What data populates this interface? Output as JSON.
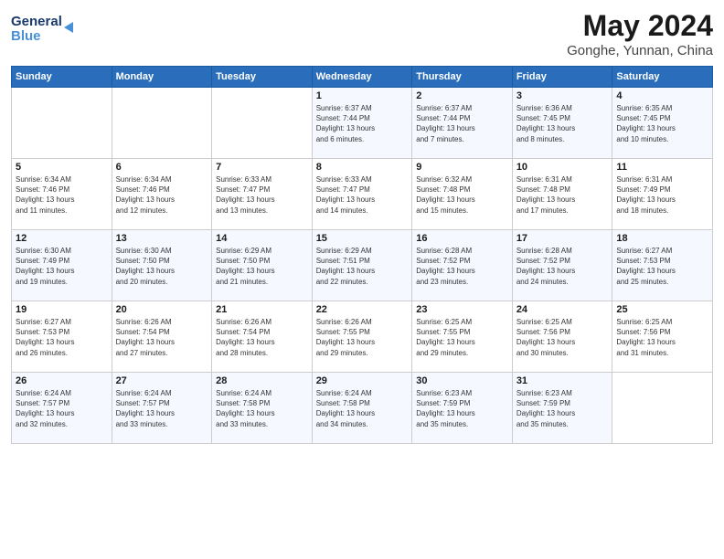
{
  "header": {
    "logo_line1": "General",
    "logo_line2": "Blue",
    "main_title": "May 2024",
    "subtitle": "Gonghe, Yunnan, China"
  },
  "weekdays": [
    "Sunday",
    "Monday",
    "Tuesday",
    "Wednesday",
    "Thursday",
    "Friday",
    "Saturday"
  ],
  "weeks": [
    [
      {
        "day": "",
        "info": ""
      },
      {
        "day": "",
        "info": ""
      },
      {
        "day": "",
        "info": ""
      },
      {
        "day": "1",
        "info": "Sunrise: 6:37 AM\nSunset: 7:44 PM\nDaylight: 13 hours\nand 6 minutes."
      },
      {
        "day": "2",
        "info": "Sunrise: 6:37 AM\nSunset: 7:44 PM\nDaylight: 13 hours\nand 7 minutes."
      },
      {
        "day": "3",
        "info": "Sunrise: 6:36 AM\nSunset: 7:45 PM\nDaylight: 13 hours\nand 8 minutes."
      },
      {
        "day": "4",
        "info": "Sunrise: 6:35 AM\nSunset: 7:45 PM\nDaylight: 13 hours\nand 10 minutes."
      }
    ],
    [
      {
        "day": "5",
        "info": "Sunrise: 6:34 AM\nSunset: 7:46 PM\nDaylight: 13 hours\nand 11 minutes."
      },
      {
        "day": "6",
        "info": "Sunrise: 6:34 AM\nSunset: 7:46 PM\nDaylight: 13 hours\nand 12 minutes."
      },
      {
        "day": "7",
        "info": "Sunrise: 6:33 AM\nSunset: 7:47 PM\nDaylight: 13 hours\nand 13 minutes."
      },
      {
        "day": "8",
        "info": "Sunrise: 6:33 AM\nSunset: 7:47 PM\nDaylight: 13 hours\nand 14 minutes."
      },
      {
        "day": "9",
        "info": "Sunrise: 6:32 AM\nSunset: 7:48 PM\nDaylight: 13 hours\nand 15 minutes."
      },
      {
        "day": "10",
        "info": "Sunrise: 6:31 AM\nSunset: 7:48 PM\nDaylight: 13 hours\nand 17 minutes."
      },
      {
        "day": "11",
        "info": "Sunrise: 6:31 AM\nSunset: 7:49 PM\nDaylight: 13 hours\nand 18 minutes."
      }
    ],
    [
      {
        "day": "12",
        "info": "Sunrise: 6:30 AM\nSunset: 7:49 PM\nDaylight: 13 hours\nand 19 minutes."
      },
      {
        "day": "13",
        "info": "Sunrise: 6:30 AM\nSunset: 7:50 PM\nDaylight: 13 hours\nand 20 minutes."
      },
      {
        "day": "14",
        "info": "Sunrise: 6:29 AM\nSunset: 7:50 PM\nDaylight: 13 hours\nand 21 minutes."
      },
      {
        "day": "15",
        "info": "Sunrise: 6:29 AM\nSunset: 7:51 PM\nDaylight: 13 hours\nand 22 minutes."
      },
      {
        "day": "16",
        "info": "Sunrise: 6:28 AM\nSunset: 7:52 PM\nDaylight: 13 hours\nand 23 minutes."
      },
      {
        "day": "17",
        "info": "Sunrise: 6:28 AM\nSunset: 7:52 PM\nDaylight: 13 hours\nand 24 minutes."
      },
      {
        "day": "18",
        "info": "Sunrise: 6:27 AM\nSunset: 7:53 PM\nDaylight: 13 hours\nand 25 minutes."
      }
    ],
    [
      {
        "day": "19",
        "info": "Sunrise: 6:27 AM\nSunset: 7:53 PM\nDaylight: 13 hours\nand 26 minutes."
      },
      {
        "day": "20",
        "info": "Sunrise: 6:26 AM\nSunset: 7:54 PM\nDaylight: 13 hours\nand 27 minutes."
      },
      {
        "day": "21",
        "info": "Sunrise: 6:26 AM\nSunset: 7:54 PM\nDaylight: 13 hours\nand 28 minutes."
      },
      {
        "day": "22",
        "info": "Sunrise: 6:26 AM\nSunset: 7:55 PM\nDaylight: 13 hours\nand 29 minutes."
      },
      {
        "day": "23",
        "info": "Sunrise: 6:25 AM\nSunset: 7:55 PM\nDaylight: 13 hours\nand 29 minutes."
      },
      {
        "day": "24",
        "info": "Sunrise: 6:25 AM\nSunset: 7:56 PM\nDaylight: 13 hours\nand 30 minutes."
      },
      {
        "day": "25",
        "info": "Sunrise: 6:25 AM\nSunset: 7:56 PM\nDaylight: 13 hours\nand 31 minutes."
      }
    ],
    [
      {
        "day": "26",
        "info": "Sunrise: 6:24 AM\nSunset: 7:57 PM\nDaylight: 13 hours\nand 32 minutes."
      },
      {
        "day": "27",
        "info": "Sunrise: 6:24 AM\nSunset: 7:57 PM\nDaylight: 13 hours\nand 33 minutes."
      },
      {
        "day": "28",
        "info": "Sunrise: 6:24 AM\nSunset: 7:58 PM\nDaylight: 13 hours\nand 33 minutes."
      },
      {
        "day": "29",
        "info": "Sunrise: 6:24 AM\nSunset: 7:58 PM\nDaylight: 13 hours\nand 34 minutes."
      },
      {
        "day": "30",
        "info": "Sunrise: 6:23 AM\nSunset: 7:59 PM\nDaylight: 13 hours\nand 35 minutes."
      },
      {
        "day": "31",
        "info": "Sunrise: 6:23 AM\nSunset: 7:59 PM\nDaylight: 13 hours\nand 35 minutes."
      },
      {
        "day": "",
        "info": ""
      }
    ]
  ]
}
